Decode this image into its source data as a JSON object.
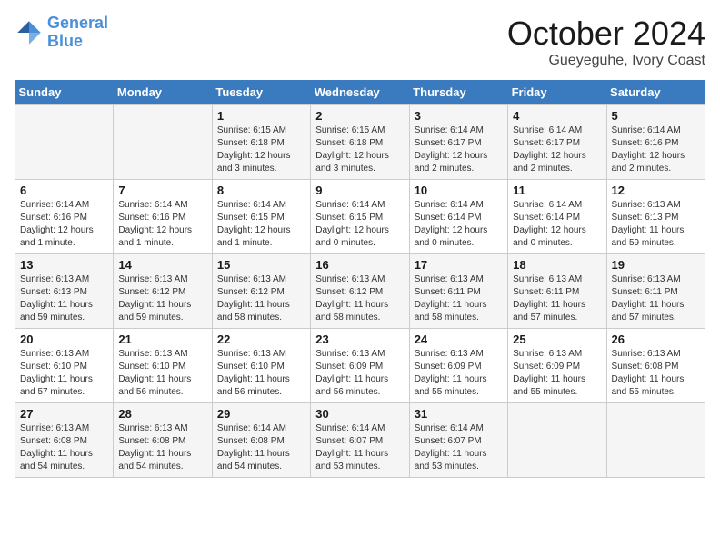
{
  "header": {
    "logo_line1": "General",
    "logo_line2": "Blue",
    "month_title": "October 2024",
    "subtitle": "Gueyeguhe, Ivory Coast"
  },
  "weekdays": [
    "Sunday",
    "Monday",
    "Tuesday",
    "Wednesday",
    "Thursday",
    "Friday",
    "Saturday"
  ],
  "rows": [
    [
      {
        "day": "",
        "sunrise": "",
        "sunset": "",
        "daylight": ""
      },
      {
        "day": "",
        "sunrise": "",
        "sunset": "",
        "daylight": ""
      },
      {
        "day": "1",
        "sunrise": "Sunrise: 6:15 AM",
        "sunset": "Sunset: 6:18 PM",
        "daylight": "Daylight: 12 hours and 3 minutes."
      },
      {
        "day": "2",
        "sunrise": "Sunrise: 6:15 AM",
        "sunset": "Sunset: 6:18 PM",
        "daylight": "Daylight: 12 hours and 3 minutes."
      },
      {
        "day": "3",
        "sunrise": "Sunrise: 6:14 AM",
        "sunset": "Sunset: 6:17 PM",
        "daylight": "Daylight: 12 hours and 2 minutes."
      },
      {
        "day": "4",
        "sunrise": "Sunrise: 6:14 AM",
        "sunset": "Sunset: 6:17 PM",
        "daylight": "Daylight: 12 hours and 2 minutes."
      },
      {
        "day": "5",
        "sunrise": "Sunrise: 6:14 AM",
        "sunset": "Sunset: 6:16 PM",
        "daylight": "Daylight: 12 hours and 2 minutes."
      }
    ],
    [
      {
        "day": "6",
        "sunrise": "Sunrise: 6:14 AM",
        "sunset": "Sunset: 6:16 PM",
        "daylight": "Daylight: 12 hours and 1 minute."
      },
      {
        "day": "7",
        "sunrise": "Sunrise: 6:14 AM",
        "sunset": "Sunset: 6:16 PM",
        "daylight": "Daylight: 12 hours and 1 minute."
      },
      {
        "day": "8",
        "sunrise": "Sunrise: 6:14 AM",
        "sunset": "Sunset: 6:15 PM",
        "daylight": "Daylight: 12 hours and 1 minute."
      },
      {
        "day": "9",
        "sunrise": "Sunrise: 6:14 AM",
        "sunset": "Sunset: 6:15 PM",
        "daylight": "Daylight: 12 hours and 0 minutes."
      },
      {
        "day": "10",
        "sunrise": "Sunrise: 6:14 AM",
        "sunset": "Sunset: 6:14 PM",
        "daylight": "Daylight: 12 hours and 0 minutes."
      },
      {
        "day": "11",
        "sunrise": "Sunrise: 6:14 AM",
        "sunset": "Sunset: 6:14 PM",
        "daylight": "Daylight: 12 hours and 0 minutes."
      },
      {
        "day": "12",
        "sunrise": "Sunrise: 6:13 AM",
        "sunset": "Sunset: 6:13 PM",
        "daylight": "Daylight: 11 hours and 59 minutes."
      }
    ],
    [
      {
        "day": "13",
        "sunrise": "Sunrise: 6:13 AM",
        "sunset": "Sunset: 6:13 PM",
        "daylight": "Daylight: 11 hours and 59 minutes."
      },
      {
        "day": "14",
        "sunrise": "Sunrise: 6:13 AM",
        "sunset": "Sunset: 6:12 PM",
        "daylight": "Daylight: 11 hours and 59 minutes."
      },
      {
        "day": "15",
        "sunrise": "Sunrise: 6:13 AM",
        "sunset": "Sunset: 6:12 PM",
        "daylight": "Daylight: 11 hours and 58 minutes."
      },
      {
        "day": "16",
        "sunrise": "Sunrise: 6:13 AM",
        "sunset": "Sunset: 6:12 PM",
        "daylight": "Daylight: 11 hours and 58 minutes."
      },
      {
        "day": "17",
        "sunrise": "Sunrise: 6:13 AM",
        "sunset": "Sunset: 6:11 PM",
        "daylight": "Daylight: 11 hours and 58 minutes."
      },
      {
        "day": "18",
        "sunrise": "Sunrise: 6:13 AM",
        "sunset": "Sunset: 6:11 PM",
        "daylight": "Daylight: 11 hours and 57 minutes."
      },
      {
        "day": "19",
        "sunrise": "Sunrise: 6:13 AM",
        "sunset": "Sunset: 6:11 PM",
        "daylight": "Daylight: 11 hours and 57 minutes."
      }
    ],
    [
      {
        "day": "20",
        "sunrise": "Sunrise: 6:13 AM",
        "sunset": "Sunset: 6:10 PM",
        "daylight": "Daylight: 11 hours and 57 minutes."
      },
      {
        "day": "21",
        "sunrise": "Sunrise: 6:13 AM",
        "sunset": "Sunset: 6:10 PM",
        "daylight": "Daylight: 11 hours and 56 minutes."
      },
      {
        "day": "22",
        "sunrise": "Sunrise: 6:13 AM",
        "sunset": "Sunset: 6:10 PM",
        "daylight": "Daylight: 11 hours and 56 minutes."
      },
      {
        "day": "23",
        "sunrise": "Sunrise: 6:13 AM",
        "sunset": "Sunset: 6:09 PM",
        "daylight": "Daylight: 11 hours and 56 minutes."
      },
      {
        "day": "24",
        "sunrise": "Sunrise: 6:13 AM",
        "sunset": "Sunset: 6:09 PM",
        "daylight": "Daylight: 11 hours and 55 minutes."
      },
      {
        "day": "25",
        "sunrise": "Sunrise: 6:13 AM",
        "sunset": "Sunset: 6:09 PM",
        "daylight": "Daylight: 11 hours and 55 minutes."
      },
      {
        "day": "26",
        "sunrise": "Sunrise: 6:13 AM",
        "sunset": "Sunset: 6:08 PM",
        "daylight": "Daylight: 11 hours and 55 minutes."
      }
    ],
    [
      {
        "day": "27",
        "sunrise": "Sunrise: 6:13 AM",
        "sunset": "Sunset: 6:08 PM",
        "daylight": "Daylight: 11 hours and 54 minutes."
      },
      {
        "day": "28",
        "sunrise": "Sunrise: 6:13 AM",
        "sunset": "Sunset: 6:08 PM",
        "daylight": "Daylight: 11 hours and 54 minutes."
      },
      {
        "day": "29",
        "sunrise": "Sunrise: 6:14 AM",
        "sunset": "Sunset: 6:08 PM",
        "daylight": "Daylight: 11 hours and 54 minutes."
      },
      {
        "day": "30",
        "sunrise": "Sunrise: 6:14 AM",
        "sunset": "Sunset: 6:07 PM",
        "daylight": "Daylight: 11 hours and 53 minutes."
      },
      {
        "day": "31",
        "sunrise": "Sunrise: 6:14 AM",
        "sunset": "Sunset: 6:07 PM",
        "daylight": "Daylight: 11 hours and 53 minutes."
      },
      {
        "day": "",
        "sunrise": "",
        "sunset": "",
        "daylight": ""
      },
      {
        "day": "",
        "sunrise": "",
        "sunset": "",
        "daylight": ""
      }
    ]
  ]
}
